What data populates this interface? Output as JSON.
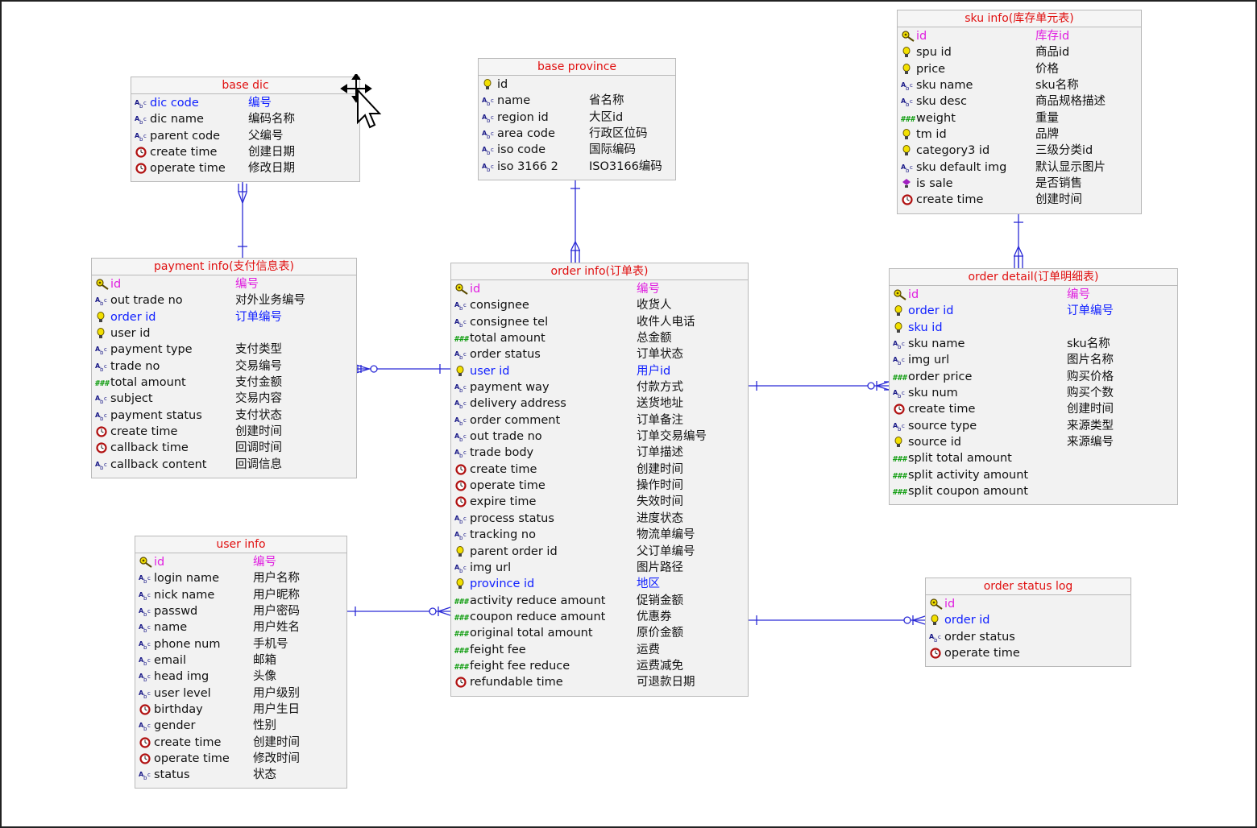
{
  "entities": {
    "base_dic": {
      "title": "base dic",
      "rows": [
        {
          "name": "dic code",
          "comment": "编号",
          "icon": "text-icon",
          "style": "fk"
        },
        {
          "name": "dic name",
          "comment": "编码名称",
          "icon": "text-icon"
        },
        {
          "name": "parent code",
          "comment": "父编号",
          "icon": "text-icon"
        },
        {
          "name": "create time",
          "comment": "创建日期",
          "icon": "clock-icon"
        },
        {
          "name": "operate time",
          "comment": "修改日期",
          "icon": "clock-icon"
        }
      ]
    },
    "base_province": {
      "title": "base province",
      "rows": [
        {
          "name": "id",
          "comment": "",
          "icon": "bulb-icon"
        },
        {
          "name": "name",
          "comment": "省名称",
          "icon": "text-icon"
        },
        {
          "name": "region id",
          "comment": "大区id",
          "icon": "text-icon"
        },
        {
          "name": "area code",
          "comment": "行政区位码",
          "icon": "text-icon"
        },
        {
          "name": "iso code",
          "comment": "国际编码",
          "icon": "text-icon"
        },
        {
          "name": "iso 3166 2",
          "comment": "ISO3166编码",
          "icon": "text-icon"
        }
      ]
    },
    "sku_info": {
      "title": "sku info(库存单元表)",
      "rows": [
        {
          "name": "id",
          "comment": "库存id",
          "icon": "key-icon",
          "style": "key"
        },
        {
          "name": "spu id",
          "comment": "商品id",
          "icon": "bulb-icon"
        },
        {
          "name": "price",
          "comment": "价格",
          "icon": "bulb-icon"
        },
        {
          "name": "sku name",
          "comment": "sku名称",
          "icon": "text-icon"
        },
        {
          "name": "sku desc",
          "comment": "商品规格描述",
          "icon": "text-icon"
        },
        {
          "name": "weight",
          "comment": "重量",
          "icon": "number-icon"
        },
        {
          "name": "tm id",
          "comment": "品牌",
          "icon": "bulb-icon"
        },
        {
          "name": "category3 id",
          "comment": "三级分类id",
          "icon": "bulb-icon"
        },
        {
          "name": "sku default img",
          "comment": "默认显示图片",
          "icon": "text-icon"
        },
        {
          "name": "is sale",
          "comment": "是否销售",
          "icon": "boolean-icon"
        },
        {
          "name": "create time",
          "comment": "创建时间",
          "icon": "clock-icon"
        }
      ]
    },
    "payment_info": {
      "title": "payment info(支付信息表)",
      "rows": [
        {
          "name": "id",
          "comment": "编号",
          "icon": "key-icon",
          "style": "key"
        },
        {
          "name": "out trade no",
          "comment": "对外业务编号",
          "icon": "text-icon"
        },
        {
          "name": "order id",
          "comment": "订单编号",
          "icon": "bulb-icon",
          "style": "fk"
        },
        {
          "name": "user id",
          "comment": "",
          "icon": "bulb-icon"
        },
        {
          "name": "payment type",
          "comment": "支付类型",
          "icon": "text-icon"
        },
        {
          "name": "trade no",
          "comment": "交易编号",
          "icon": "text-icon"
        },
        {
          "name": "total amount",
          "comment": "支付金额",
          "icon": "number-icon"
        },
        {
          "name": "subject",
          "comment": "交易内容",
          "icon": "text-icon"
        },
        {
          "name": "payment status",
          "comment": "支付状态",
          "icon": "text-icon"
        },
        {
          "name": "create time",
          "comment": "创建时间",
          "icon": "clock-icon"
        },
        {
          "name": "callback time",
          "comment": "回调时间",
          "icon": "clock-icon"
        },
        {
          "name": "callback content",
          "comment": "回调信息",
          "icon": "text-icon"
        }
      ]
    },
    "order_info": {
      "title": "order info(订单表)",
      "rows": [
        {
          "name": "id",
          "comment": "编号",
          "icon": "key-icon",
          "style": "key"
        },
        {
          "name": "consignee",
          "comment": "收货人",
          "icon": "text-icon"
        },
        {
          "name": "consignee tel",
          "comment": "收件人电话",
          "icon": "text-icon"
        },
        {
          "name": "total amount",
          "comment": "总金额",
          "icon": "number-icon"
        },
        {
          "name": "order status",
          "comment": "订单状态",
          "icon": "text-icon"
        },
        {
          "name": "user id",
          "comment": "用户id",
          "icon": "bulb-icon",
          "style": "fk"
        },
        {
          "name": "payment way",
          "comment": "付款方式",
          "icon": "text-icon"
        },
        {
          "name": "delivery address",
          "comment": "送货地址",
          "icon": "text-icon"
        },
        {
          "name": "order comment",
          "comment": "订单备注",
          "icon": "text-icon"
        },
        {
          "name": "out trade no",
          "comment": "订单交易编号",
          "icon": "text-icon"
        },
        {
          "name": "trade body",
          "comment": "订单描述",
          "icon": "text-icon"
        },
        {
          "name": "create time",
          "comment": "创建时间",
          "icon": "clock-icon"
        },
        {
          "name": "operate time",
          "comment": "操作时间",
          "icon": "clock-icon"
        },
        {
          "name": "expire time",
          "comment": "失效时间",
          "icon": "clock-icon"
        },
        {
          "name": "process status",
          "comment": "进度状态",
          "icon": "text-icon"
        },
        {
          "name": "tracking no",
          "comment": "物流单编号",
          "icon": "text-icon"
        },
        {
          "name": "parent order id",
          "comment": "父订单编号",
          "icon": "bulb-icon"
        },
        {
          "name": "img url",
          "comment": "图片路径",
          "icon": "text-icon"
        },
        {
          "name": "province id",
          "comment": "地区",
          "icon": "bulb-icon",
          "style": "fk"
        },
        {
          "name": "activity reduce amount",
          "comment": "促销金额",
          "icon": "number-icon"
        },
        {
          "name": "coupon reduce amount",
          "comment": "优惠券",
          "icon": "number-icon"
        },
        {
          "name": "original total amount",
          "comment": "原价金额",
          "icon": "number-icon"
        },
        {
          "name": "feight fee",
          "comment": "运费",
          "icon": "number-icon"
        },
        {
          "name": "feight fee reduce",
          "comment": "运费减免",
          "icon": "number-icon"
        },
        {
          "name": "refundable time",
          "comment": "可退款日期",
          "icon": "clock-icon"
        }
      ]
    },
    "order_detail": {
      "title": "order detail(订单明细表)",
      "rows": [
        {
          "name": "id",
          "comment": "编号",
          "icon": "key-icon",
          "style": "key"
        },
        {
          "name": "order id",
          "comment": "订单编号",
          "icon": "bulb-icon",
          "style": "fk"
        },
        {
          "name": "sku id",
          "comment": "",
          "icon": "bulb-icon",
          "style": "fk"
        },
        {
          "name": "sku name",
          "comment": "sku名称",
          "icon": "text-icon"
        },
        {
          "name": "img url",
          "comment": "图片名称",
          "icon": "text-icon"
        },
        {
          "name": "order price",
          "comment": "购买价格",
          "icon": "number-icon"
        },
        {
          "name": "sku num",
          "comment": "购买个数",
          "icon": "text-icon"
        },
        {
          "name": "create time",
          "comment": "创建时间",
          "icon": "clock-icon"
        },
        {
          "name": "source type",
          "comment": "来源类型",
          "icon": "text-icon"
        },
        {
          "name": "source id",
          "comment": "来源编号",
          "icon": "bulb-icon"
        },
        {
          "name": "split total amount",
          "comment": "",
          "icon": "number-icon"
        },
        {
          "name": "split activity amount",
          "comment": "",
          "icon": "number-icon"
        },
        {
          "name": "split coupon amount",
          "comment": "",
          "icon": "number-icon"
        }
      ]
    },
    "user_info": {
      "title": "user info",
      "rows": [
        {
          "name": "id",
          "comment": "编号",
          "icon": "key-icon",
          "style": "key"
        },
        {
          "name": "login name",
          "comment": "用户名称",
          "icon": "text-icon"
        },
        {
          "name": "nick name",
          "comment": "用户昵称",
          "icon": "text-icon"
        },
        {
          "name": "passwd",
          "comment": "用户密码",
          "icon": "text-icon"
        },
        {
          "name": "name",
          "comment": "用户姓名",
          "icon": "text-icon"
        },
        {
          "name": "phone num",
          "comment": "手机号",
          "icon": "text-icon"
        },
        {
          "name": "email",
          "comment": "邮箱",
          "icon": "text-icon"
        },
        {
          "name": "head img",
          "comment": "头像",
          "icon": "text-icon"
        },
        {
          "name": "user level",
          "comment": "用户级别",
          "icon": "text-icon"
        },
        {
          "name": "birthday",
          "comment": "用户生日",
          "icon": "clock-icon"
        },
        {
          "name": "gender",
          "comment": "性别",
          "icon": "text-icon"
        },
        {
          "name": "create time",
          "comment": "创建时间",
          "icon": "clock-icon"
        },
        {
          "name": "operate time",
          "comment": "修改时间",
          "icon": "clock-icon"
        },
        {
          "name": "status",
          "comment": "状态",
          "icon": "text-icon"
        }
      ]
    },
    "order_status_log": {
      "title": "order status log",
      "rows": [
        {
          "name": "id",
          "comment": "",
          "icon": "key-icon",
          "style": "key"
        },
        {
          "name": "order id",
          "comment": "",
          "icon": "bulb-icon",
          "style": "fk"
        },
        {
          "name": "order status",
          "comment": "",
          "icon": "text-icon"
        },
        {
          "name": "operate time",
          "comment": "",
          "icon": "clock-icon"
        }
      ]
    }
  },
  "colors": {
    "title": "#e01010",
    "key": "#e020e0",
    "foreign_key": "#1020ff",
    "line": "#2b2bd6"
  },
  "cursor_icon": "move-cursor-icon"
}
